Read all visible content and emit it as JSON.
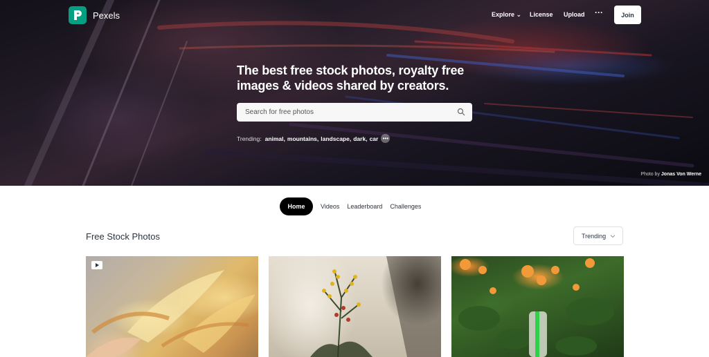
{
  "brand": {
    "name": "Pexels",
    "accent": "#05a081"
  },
  "nav": {
    "explore": "Explore",
    "license": "License",
    "upload": "Upload",
    "more": "···",
    "join": "Join"
  },
  "hero": {
    "headline_line1": "The best free stock photos, royalty free",
    "headline_line2": "images & videos shared by creators.",
    "search_placeholder": "Search for free photos",
    "trending_label": "Trending:",
    "trending_tags": [
      "animal",
      "mountains",
      "landscape",
      "dark",
      "car"
    ],
    "credit_prefix": "Photo by",
    "credit_author": "Jonas Von Werne"
  },
  "tabs": [
    "Home",
    "Videos",
    "Leaderboard",
    "Challenges"
  ],
  "section": {
    "title": "Free Stock Photos",
    "sort_value": "Trending"
  },
  "photos": [
    {
      "icon": "video-icon"
    },
    {
      "icon": ""
    },
    {
      "icon": ""
    }
  ]
}
